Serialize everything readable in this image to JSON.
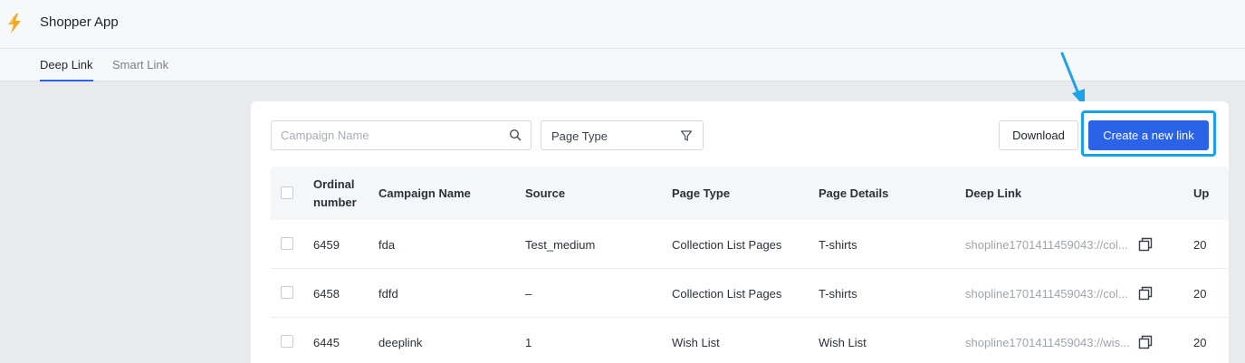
{
  "app": {
    "title": "Shopper App",
    "logo_icon": "lightning-logo-icon",
    "accent": "#2a62e8"
  },
  "tabs": [
    {
      "label": "Deep Link",
      "active": true
    },
    {
      "label": "Smart Link",
      "active": false
    }
  ],
  "toolbar": {
    "search_placeholder": "Campaign Name",
    "search_icon": "search-icon",
    "page_type_label": "Page Type",
    "filter_icon": "filter-icon",
    "download_label": "Download",
    "create_label": "Create a new link",
    "highlight_color": "#1ba3e8"
  },
  "table": {
    "columns": [
      "Ordinal number",
      "Campaign Name",
      "Source",
      "Page Type",
      "Page Details",
      "Deep Link",
      "Up"
    ],
    "rows": [
      {
        "ordinal": "6459",
        "campaign": "fda",
        "source": "Test_medium",
        "page_type": "Collection List Pages",
        "page_details": "T-shirts",
        "deep_link": "shopline1701411459043://col...",
        "updated": "20"
      },
      {
        "ordinal": "6458",
        "campaign": "fdfd",
        "source": "–",
        "page_type": "Collection List Pages",
        "page_details": "T-shirts",
        "deep_link": "shopline1701411459043://col...",
        "updated": "20"
      },
      {
        "ordinal": "6445",
        "campaign": "deeplink",
        "source": "1",
        "page_type": "Wish List",
        "page_details": "Wish List",
        "deep_link": "shopline1701411459043://wis...",
        "updated": "20"
      }
    ]
  }
}
